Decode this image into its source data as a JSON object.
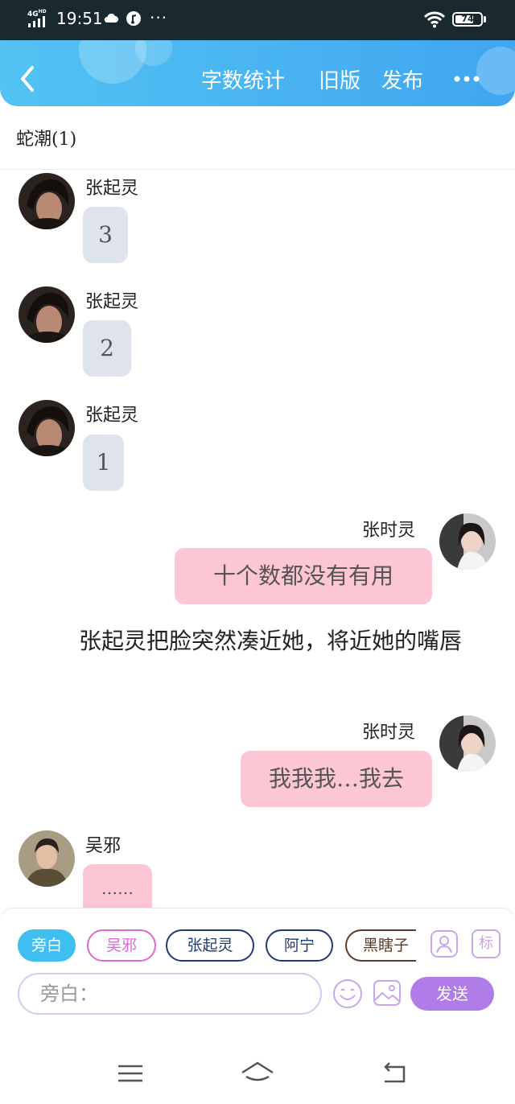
{
  "status_bar": {
    "network": "4G",
    "network_sup": "HD",
    "time": "19:51",
    "more": "···",
    "battery": "74",
    "battery_level": 0.74
  },
  "header": {
    "word_count": "字数统计",
    "old_version": "旧版",
    "publish": "发布",
    "more": "•••",
    "icons": [
      "back-arrow-icon",
      "more-icon"
    ],
    "colors": {
      "start": "#52c3f2",
      "end": "#40a6f0"
    }
  },
  "room": {
    "title": "蛇潮(1)"
  },
  "messages": [
    {
      "speaker": "张起灵",
      "text": "3",
      "style": "gray",
      "side": "left"
    },
    {
      "speaker": "张起灵",
      "text": "2",
      "style": "gray",
      "side": "left"
    },
    {
      "speaker": "张起灵",
      "text": "1",
      "style": "gray",
      "side": "left"
    },
    {
      "speaker": "张时灵",
      "text": "十个数都没有有用",
      "style": "pink",
      "side": "right"
    },
    {
      "type": "narration",
      "text": "张起灵把脸突然凑近她，将近她的嘴唇"
    },
    {
      "speaker": "张时灵",
      "text": "我我我…我去",
      "style": "pink",
      "side": "right"
    },
    {
      "speaker": "吴邪",
      "text": "……",
      "style": "pink",
      "side": "left"
    }
  ],
  "composer": {
    "characters": [
      {
        "label": "旁白",
        "color": "#3fbef0",
        "selected": true
      },
      {
        "label": "吴邪",
        "color": "#d968d9",
        "selected": false
      },
      {
        "label": "张起灵",
        "color": "#1e3a6e",
        "selected": false
      },
      {
        "label": "阿宁",
        "color": "#1e3a6e",
        "selected": false
      },
      {
        "label": "黑瞎子",
        "color": "#5a3a2a",
        "selected": false
      }
    ],
    "tag_label": "标",
    "placeholder": "旁白：",
    "send_label": "发送",
    "send_color": "#b07ce8"
  },
  "nav": {
    "icons": [
      "menu-icon",
      "home-icon",
      "back-icon"
    ]
  }
}
